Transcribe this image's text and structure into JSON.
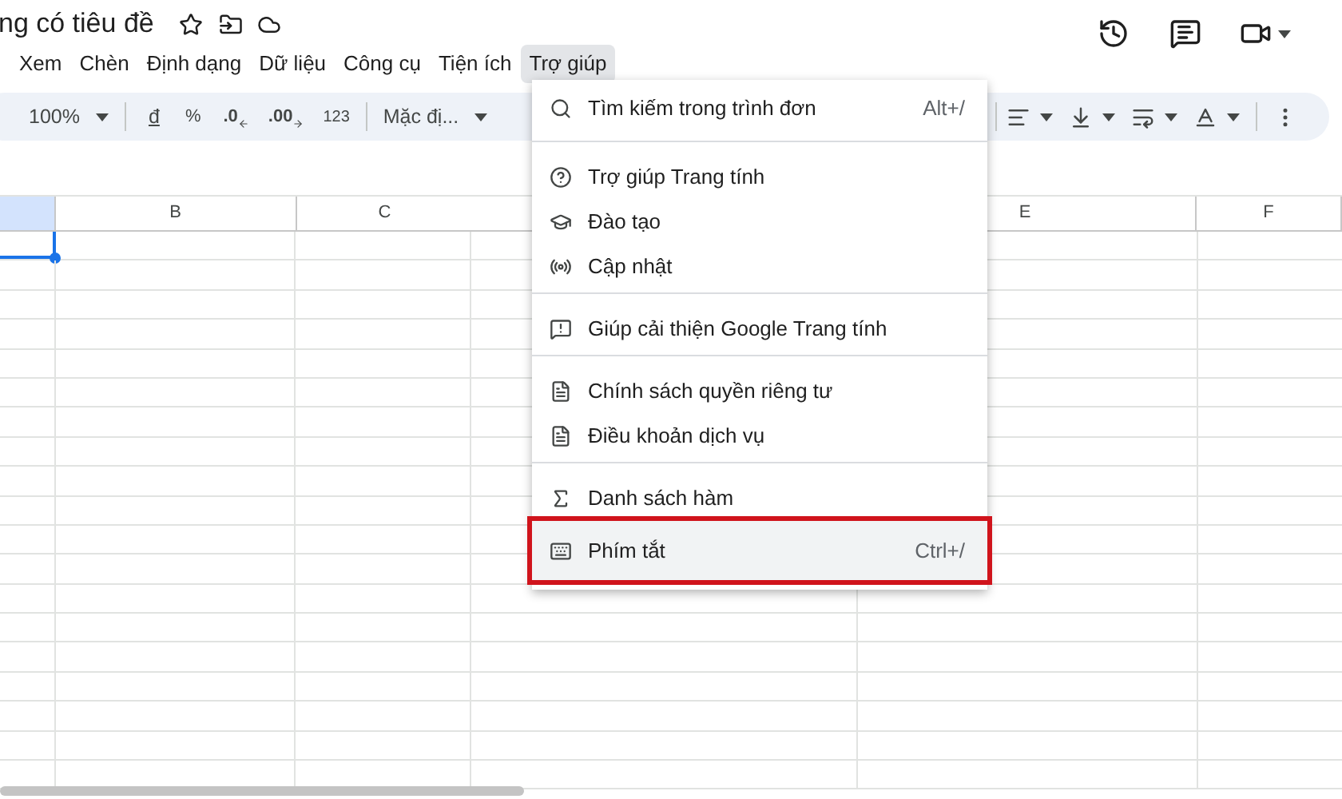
{
  "document": {
    "title": "ng có tiêu đề"
  },
  "menu_bar": [
    {
      "label": "Xem",
      "selected": false
    },
    {
      "label": "Chèn",
      "selected": false
    },
    {
      "label": "Định dạng",
      "selected": false
    },
    {
      "label": "Dữ liệu",
      "selected": false
    },
    {
      "label": "Công cụ",
      "selected": false
    },
    {
      "label": "Tiện ích",
      "selected": false
    },
    {
      "label": "Trợ giúp",
      "selected": true
    }
  ],
  "toolbar": {
    "zoom": "100%",
    "currency": "đ",
    "percent": "%",
    "decrease_decimal": ".0",
    "increase_decimal": ".00",
    "number_format": "123",
    "font": "Mặc đị..."
  },
  "sheet": {
    "columns": [
      {
        "label": "B"
      },
      {
        "label": "C"
      },
      {
        "label": "E"
      },
      {
        "label": "F"
      }
    ]
  },
  "help_menu": {
    "groups": [
      {
        "items": [
          {
            "label": "Tìm kiếm trong trình đơn",
            "shortcut": "Alt+/",
            "highlighted": false
          }
        ]
      },
      {
        "items": [
          {
            "label": "Trợ giúp Trang tính",
            "highlighted": false
          },
          {
            "label": "Đào tạo",
            "highlighted": false
          },
          {
            "label": "Cập nhật",
            "highlighted": false
          }
        ]
      },
      {
        "items": [
          {
            "label": "Giúp cải thiện Google Trang tính",
            "highlighted": false
          }
        ]
      },
      {
        "items": [
          {
            "label": "Chính sách quyền riêng tư",
            "highlighted": false
          },
          {
            "label": "Điều khoản dịch vụ",
            "highlighted": false
          }
        ]
      },
      {
        "items": [
          {
            "label": "Danh sách hàm",
            "highlighted": false
          },
          {
            "label": "Phím tắt",
            "shortcut": "Ctrl+/",
            "highlighted": true
          }
        ]
      }
    ]
  }
}
